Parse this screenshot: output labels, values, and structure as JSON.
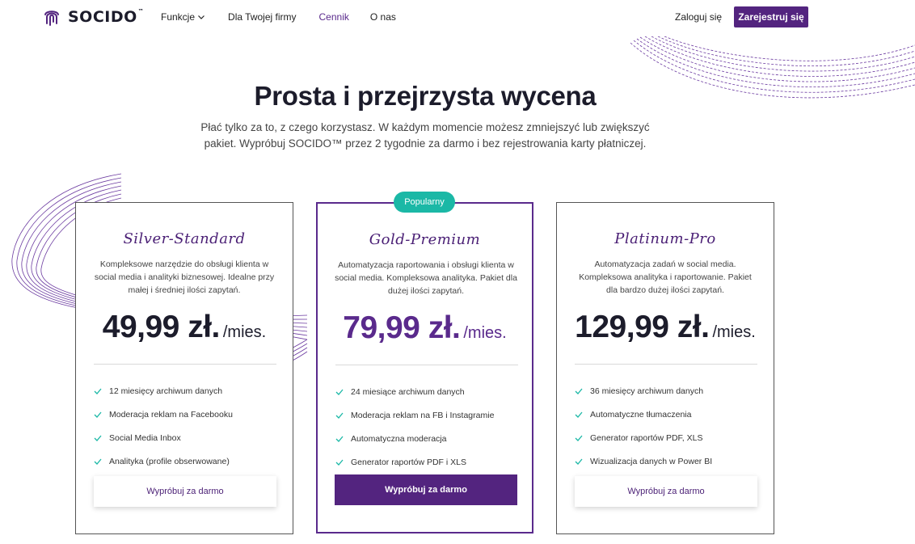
{
  "nav": {
    "logo_text": "SOCIDO",
    "logo_tm": "™",
    "links": [
      {
        "label": "Funkcje"
      },
      {
        "label": "Dla Twojej firmy"
      },
      {
        "label": "Cennik"
      },
      {
        "label": "O nas"
      }
    ],
    "login": "Zaloguj się",
    "register": "Zarejestruj się"
  },
  "hero": {
    "title": "Prosta i przejrzysta wycena",
    "subtitle": "Płać tylko za to, z czego korzystasz. W każdym momencie możesz zmniejszyć lub zwiększyć pakiet. Wypróbuj SOCIDO™ przez 2 tygodnie za darmo i bez rejestrowania karty płatniczej."
  },
  "badge": "Popularny",
  "plans": [
    {
      "name": "Silver-Standard",
      "description": "Kompleksowe narzędzie do obsługi klienta w social media i analityki biznesowej. Idealne przy małej i średniej ilości zapytań.",
      "price": "49,99 zł.",
      "period": "/mies.",
      "features": [
        "12 miesięcy archiwum danych",
        "Moderacja reklam na Facebooku",
        "Social Media Inbox",
        "Analityka (profile obserwowane)"
      ],
      "cta": "Wypróbuj za darmo"
    },
    {
      "name": "Gold-Premium",
      "description": "Automatyzacja raportowania i obsługi klienta w social media. Kompleksowa analityka. Pakiet dla dużej ilości zapytań.",
      "price": "79,99 zł.",
      "period": "/mies.",
      "features": [
        "24 miesiące archiwum danych",
        "Moderacja reklam na FB i Instagramie",
        "Automatyczna moderacja",
        "Generator raportów PDF i XLS"
      ],
      "cta": "Wypróbuj za darmo"
    },
    {
      "name": "Platinum-Pro",
      "description": "Automatyzacja zadań w social media. Kompleksowa analityka i raportowanie. Pakiet dla bardzo dużej ilości zapytań.",
      "price": "129,99 zł.",
      "period": "/mies.",
      "features": [
        "36 miesięcy archiwum danych",
        "Automatyczne tłumaczenia",
        "Generator raportów PDF, XLS",
        "Wizualizacja danych w Power BI"
      ],
      "cta": "Wypróbuj za darmo"
    }
  ],
  "colors": {
    "brand": "#53247f",
    "accent_teal": "#1bb8a6",
    "check": "#1bb8a6"
  }
}
